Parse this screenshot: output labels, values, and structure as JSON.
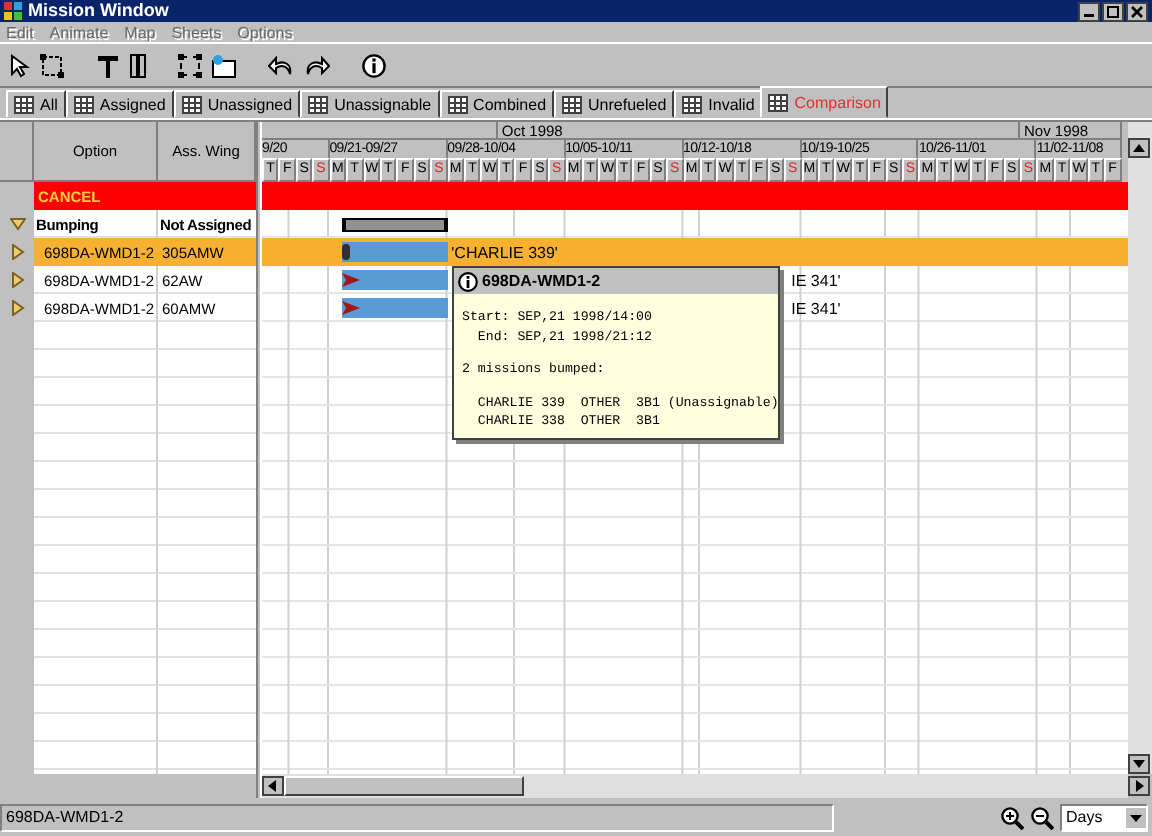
{
  "window": {
    "title": "Mission Window"
  },
  "menu": [
    {
      "label": "Edit",
      "disabled": true
    },
    {
      "label": "Animate",
      "disabled": true
    },
    {
      "label": "Map",
      "disabled": true
    },
    {
      "label": "Sheets",
      "disabled": true
    },
    {
      "label": "Options",
      "disabled": true
    }
  ],
  "tabs": [
    {
      "label": "All",
      "selected": false
    },
    {
      "label": "Assigned",
      "selected": false
    },
    {
      "label": "Unassigned",
      "selected": false
    },
    {
      "label": "Unassignable",
      "selected": false
    },
    {
      "label": "Combined",
      "selected": false
    },
    {
      "label": "Unrefueled",
      "selected": false
    },
    {
      "label": "Invalid",
      "selected": false
    },
    {
      "label": "Comparison",
      "selected": true
    }
  ],
  "columns": [
    "Option",
    "Ass. Wing"
  ],
  "timeline": {
    "weeks": [
      {
        "label": "9/20",
        "days": [
          {
            "d": "T"
          },
          {
            "d": "F"
          },
          {
            "d": "S"
          },
          {
            "d": "S",
            "red": true
          }
        ]
      },
      {
        "label": "09/21-09/27",
        "days": [
          {
            "d": "M"
          },
          {
            "d": "T"
          },
          {
            "d": "W"
          },
          {
            "d": "T"
          },
          {
            "d": "F"
          },
          {
            "d": "S"
          },
          {
            "d": "S",
            "red": true
          }
        ]
      },
      {
        "label": "09/28-10/04",
        "days": [
          {
            "d": "M"
          },
          {
            "d": "T"
          },
          {
            "d": "W"
          },
          {
            "d": "T",
            "month": "Oct 1998"
          },
          {
            "d": "F"
          },
          {
            "d": "S"
          },
          {
            "d": "S",
            "red": true
          }
        ]
      },
      {
        "label": "10/05-10/11",
        "days": [
          {
            "d": "M"
          },
          {
            "d": "T"
          },
          {
            "d": "W"
          },
          {
            "d": "T"
          },
          {
            "d": "F"
          },
          {
            "d": "S"
          },
          {
            "d": "S",
            "red": true
          }
        ]
      },
      {
        "label": "10/12-10/18",
        "days": [
          {
            "d": "M"
          },
          {
            "d": "T"
          },
          {
            "d": "W"
          },
          {
            "d": "T"
          },
          {
            "d": "F"
          },
          {
            "d": "S"
          },
          {
            "d": "S",
            "red": true
          }
        ]
      },
      {
        "label": "10/19-10/25",
        "days": [
          {
            "d": "M"
          },
          {
            "d": "T"
          },
          {
            "d": "W"
          },
          {
            "d": "T"
          },
          {
            "d": "F"
          },
          {
            "d": "S"
          },
          {
            "d": "S",
            "red": true
          }
        ]
      },
      {
        "label": "10/26-11/01",
        "days": [
          {
            "d": "M"
          },
          {
            "d": "T"
          },
          {
            "d": "W"
          },
          {
            "d": "T"
          },
          {
            "d": "F"
          },
          {
            "d": "S"
          },
          {
            "d": "S",
            "red": true,
            "month": "Nov 1998"
          }
        ]
      },
      {
        "label": "11/02-11/08",
        "days": [
          {
            "d": "M"
          },
          {
            "d": "T"
          },
          {
            "d": "W"
          },
          {
            "d": "T"
          },
          {
            "d": "F"
          }
        ]
      }
    ]
  },
  "rows": [
    {
      "kind": "cancel",
      "option": "CANCEL"
    },
    {
      "kind": "group",
      "option": "Bumping",
      "wing": "Not Assigned",
      "expanded": true
    },
    {
      "kind": "item",
      "option": "698DA-WMD1-2",
      "wing": "305AMW",
      "expanded": false,
      "selected": true,
      "bar": {
        "kind": "dot",
        "label": "'CHARLIE 339'",
        "covered": false
      }
    },
    {
      "kind": "item",
      "option": "698DA-WMD1-2",
      "wing": "62AW",
      "expanded": false,
      "selected": false,
      "bar": {
        "kind": "arrow",
        "label": "IE 341'",
        "covered": true
      }
    },
    {
      "kind": "item",
      "option": "698DA-WMD1-2",
      "wing": "60AMW",
      "expanded": false,
      "selected": false,
      "bar": {
        "kind": "arrow",
        "label": "IE 341'",
        "covered": true
      }
    }
  ],
  "tooltip": {
    "title": "698DA-WMD1-2",
    "paragraphs": [
      [
        "Start: SEP,21 1998/14:00",
        "  End: SEP,21 1998/21:12"
      ],
      [
        "2 missions bumped:"
      ],
      [
        "  CHARLIE 339  OTHER  3B1 (Unassignable)",
        "  CHARLIE 338  OTHER  3B1"
      ]
    ]
  },
  "status_bar": {
    "text": "698DA-WMD1-2",
    "scale": "Days"
  }
}
